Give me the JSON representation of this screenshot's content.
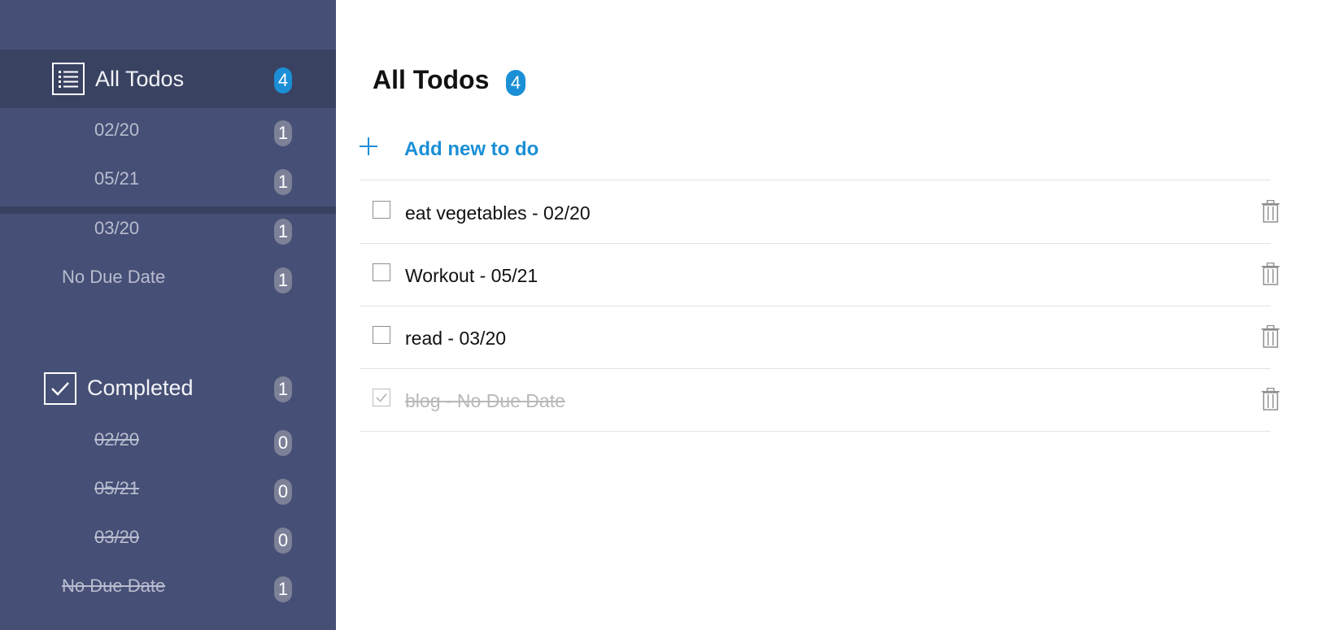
{
  "sidebar": {
    "all_todos": {
      "label": "All Todos",
      "count": "4",
      "icon": "list-icon",
      "items": [
        {
          "label": "02/20",
          "count": "1"
        },
        {
          "label": "05/21",
          "count": "1"
        },
        {
          "label": "03/20",
          "count": "1"
        },
        {
          "label": "No Due Date",
          "count": "1"
        }
      ]
    },
    "completed": {
      "label": "Completed",
      "count": "1",
      "icon": "checkbox-checked-icon",
      "items": [
        {
          "label": "02/20",
          "count": "0"
        },
        {
          "label": "05/21",
          "count": "0"
        },
        {
          "label": "03/20",
          "count": "0"
        },
        {
          "label": "No Due Date",
          "count": "1"
        }
      ]
    }
  },
  "main": {
    "title": "All Todos",
    "count": "4",
    "add_label": "Add new to do",
    "todos": [
      {
        "text": "eat vegetables - 02/20",
        "completed": false
      },
      {
        "text": "Workout - 05/21",
        "completed": false
      },
      {
        "text": "read - 03/20",
        "completed": false
      },
      {
        "text": "blog - No Due Date",
        "completed": true
      }
    ]
  },
  "colors": {
    "sidebar_bg": "#464f75",
    "sidebar_active": "#3a4262",
    "accent": "#1a8fd6",
    "badge_gray": "#7c8198"
  }
}
